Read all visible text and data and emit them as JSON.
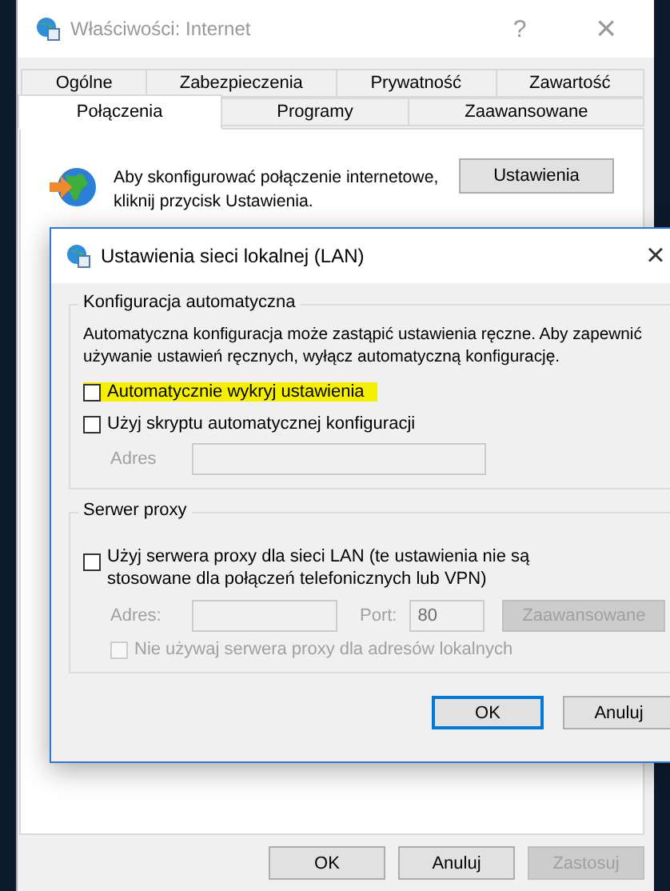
{
  "window": {
    "title": "Właściwości: Internet",
    "help": "?",
    "close": "×",
    "active": false
  },
  "tabs_top": [
    {
      "label": "Ogólne",
      "selected": false
    },
    {
      "label": "Zabezpieczenia",
      "selected": false
    },
    {
      "label": "Prywatność",
      "selected": false
    },
    {
      "label": "Zawartość",
      "selected": false
    }
  ],
  "tabs_bottom": [
    {
      "label": "Połączenia",
      "selected": true
    },
    {
      "label": "Programy",
      "selected": false
    },
    {
      "label": "Zaawansowane",
      "selected": false
    }
  ],
  "connection": {
    "text": "Aby skonfigurować połączenie internetowe, kliknij przycisk Ustawienia.",
    "button": "Ustawienia"
  },
  "buttons": [
    {
      "label": "OK",
      "disabled": false
    },
    {
      "label": "Anuluj",
      "disabled": false
    },
    {
      "label": "Zastosuj",
      "disabled": true
    }
  ],
  "dialog": {
    "title": "Ustawienia sieci lokalnej (LAN)",
    "close": "×",
    "auto_group": {
      "legend": "Konfiguracja automatyczna",
      "description": "Automatyczna konfiguracja może zastąpić ustawienia ręczne. Aby zapewnić używanie ustawień ręcznych, wyłącz automatyczną konfigurację.",
      "checkboxes": [
        {
          "label": "Automatycznie wykryj ustawienia",
          "checked": false,
          "highlighted": true,
          "disabled": false
        },
        {
          "label": "Użyj skryptu automatycznej konfiguracji",
          "checked": false,
          "highlighted": false,
          "disabled": false
        }
      ],
      "address": {
        "label": "Adres",
        "disabled": true
      }
    },
    "proxy_group": {
      "legend": "Serwer proxy",
      "use_proxy": {
        "label": "Użyj serwera proxy dla sieci LAN (te ustawienia nie są stosowane dla połączeń telefonicznych lub VPN)",
        "checked": false,
        "disabled": false
      },
      "address": {
        "label": "Adres:",
        "disabled": true
      },
      "port": {
        "label": "Port:",
        "value": "80",
        "disabled": true
      },
      "advanced": {
        "label": "Zaawansowane",
        "disabled": true
      },
      "bypass": {
        "label": "Nie używaj serwera proxy dla adresów lokalnych",
        "checked": false,
        "disabled": true
      }
    },
    "buttons": [
      {
        "label": "OK",
        "default": true
      },
      {
        "label": "Anuluj",
        "default": false
      }
    ]
  }
}
